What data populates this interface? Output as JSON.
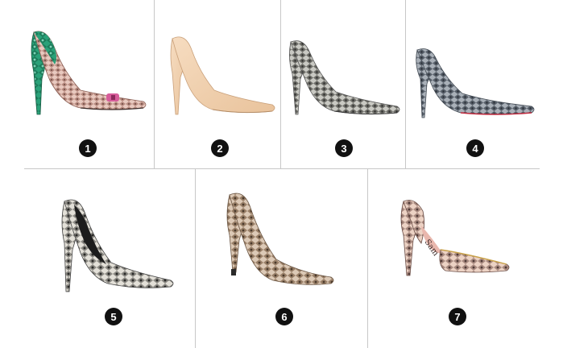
{
  "items": [
    {
      "number": "1",
      "description": "Pointed-toe stiletto pump in green and pink snakeskin with bow ornament"
    },
    {
      "number": "2",
      "description": "Pointed-toe stiletto pump in nude/cream snake texture"
    },
    {
      "number": "3",
      "description": "Pointed-toe stiletto pump in grey python print"
    },
    {
      "number": "4",
      "description": "Pointed-toe stiletto pump in grey/blue python print with red sole"
    },
    {
      "number": "5",
      "description": "Pointed-toe stiletto pump in black and white python print"
    },
    {
      "number": "6",
      "description": "Pointed-toe stiletto pump in taupe/brown python print"
    },
    {
      "number": "7",
      "description": "D'Orsay pointed-toe pump in pink python print with gold trim and logo insole"
    }
  ],
  "colors": {
    "badge": "#111111",
    "divider": "#c8c8c8",
    "background": "#ffffff"
  }
}
